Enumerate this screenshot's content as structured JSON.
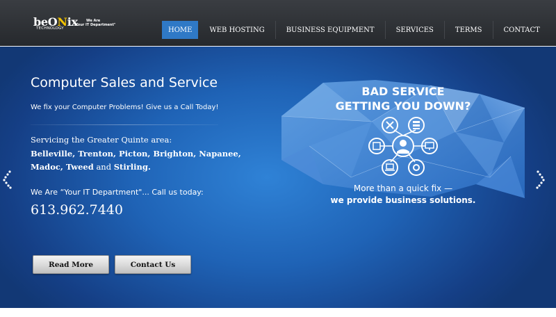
{
  "header": {
    "logo": {
      "brand_prefix": "beO",
      "brand_o": "N",
      "brand_suffix": "ix",
      "sub": "TECHNOLOGY",
      "tag_line1": "We Are",
      "tag_line2": "\"Your IT Department\""
    },
    "nav": [
      {
        "label": "HOME",
        "active": true
      },
      {
        "label": "WEB HOSTING"
      },
      {
        "label": "BUSINESS EQUIPMENT"
      },
      {
        "label": "SERVICES"
      },
      {
        "label": "TERMS"
      },
      {
        "label": "CONTACT"
      }
    ]
  },
  "hero": {
    "title": "Computer Sales and Service",
    "tagline": "We fix your Computer Problems! Give us a Call Today!",
    "serving_intro": "Servicing the Greater Quinte area:",
    "towns_line1": "Belleville, Trenton, Picton, Brighton, Napanee,",
    "towns_line2a": "Madoc, Tweed",
    "towns_and": "and",
    "towns_line2b": "Stirling.",
    "call_text": "We Are “Your IT Department\"... Call us today:",
    "phone": "613.962.7440",
    "buttons": {
      "read_more": "Read More",
      "contact_us": "Contact Us"
    }
  },
  "slide": {
    "headline_line1": "BAD SERVICE",
    "headline_line2": "GETTING YOU DOWN?",
    "sub_line1": "More than a quick fix —",
    "sub_line2": "we provide business solutions."
  },
  "colors": {
    "header_bg": "#2c2f33",
    "nav_active": "#2f79c6",
    "hero_blue": "#1f63b6",
    "logo_accent": "#f2c200"
  },
  "icons": [
    "arrow-left-icon",
    "arrow-right-icon",
    "support-agent-icon",
    "tools-icon",
    "server-icon",
    "monitor-icon",
    "laptop-icon",
    "settings-icon",
    "document-icon"
  ]
}
